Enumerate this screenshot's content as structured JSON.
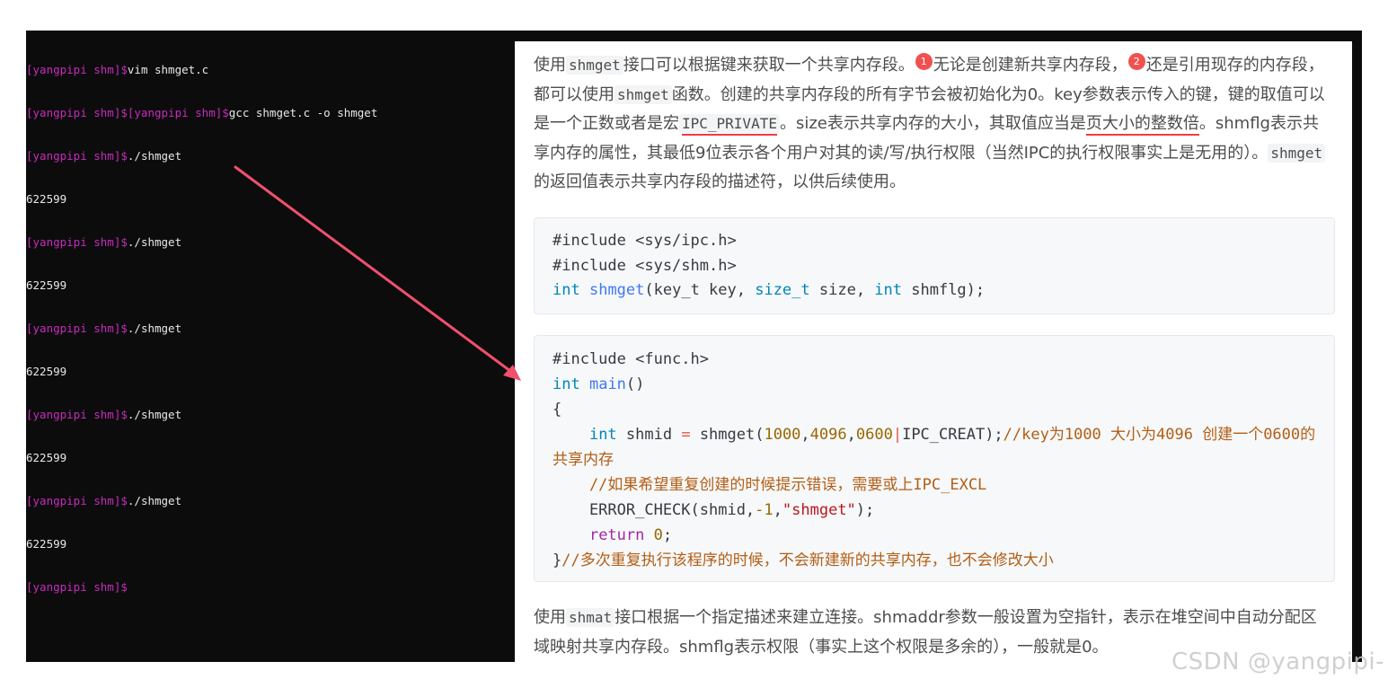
{
  "terminal": {
    "lines": [
      {
        "prompt": "[yangpipi shm]$",
        "cmd": "vim shmget.c"
      },
      {
        "prompt": "[yangpipi shm]$[yangpipi shm]$",
        "cmd": "gcc shmget.c -o shmget"
      },
      {
        "prompt": "[yangpipi shm]$",
        "cmd": "./shmget"
      },
      {
        "prompt": "",
        "cmd": "622599"
      },
      {
        "prompt": "[yangpipi shm]$",
        "cmd": "./shmget"
      },
      {
        "prompt": "",
        "cmd": "622599"
      },
      {
        "prompt": "[yangpipi shm]$",
        "cmd": "./shmget"
      },
      {
        "prompt": "",
        "cmd": "622599"
      },
      {
        "prompt": "[yangpipi shm]$",
        "cmd": "./shmget"
      },
      {
        "prompt": "",
        "cmd": "622599"
      },
      {
        "prompt": "[yangpipi shm]$",
        "cmd": "./shmget"
      },
      {
        "prompt": "",
        "cmd": "622599"
      },
      {
        "prompt": "[yangpipi shm]$",
        "cmd": ""
      }
    ]
  },
  "article": {
    "p1": {
      "t1": "使用",
      "c1": "shmget",
      "t2": "接口可以根据键来获取一个共享内存段。",
      "badge1": "1",
      "t3": "无论是创建新共享内存段，",
      "badge2": "2",
      "t4": "还是引用现存的内存段，都可以使用",
      "c2": "shmget",
      "t5": "函数。创建的共享内存段的所有字节会被初始化为0。key参数表示传入的键，键的取值可以是一个正数或者是宏",
      "c3": "IPC_PRIVATE",
      "t6": "。size表示共享内存的大小，其取值应当是",
      "u1": "页大小的整数倍",
      "t7": "。shmflg表示共享内存的属性，其最低9位表示各个用户对其的读/写/执行权限（当然IPC的执行权限事实上是无用的）。",
      "c4": "shmget",
      "t8": "的返回值表示共享内存段的描述符，以供后续使用。"
    },
    "code1": {
      "l1": "#include <sys/ipc.h>",
      "l2": "#include <sys/shm.h>",
      "l3_kw1": "int",
      "l3_fn": "shmget",
      "l3_a": "(key_t key, ",
      "l3_kw2": "size_t",
      "l3_b": " size, ",
      "l3_kw3": "int",
      "l3_c": " shmflg);"
    },
    "code2": {
      "l1": "#include <func.h>",
      "l2_kw": "int",
      "l2_fn": "main",
      "l2_rest": "()",
      "l3": "{",
      "l4_indent": "    ",
      "l4_kw": "int",
      "l4_a": " shmid ",
      "l4_op": "=",
      "l4_b": " shmget(",
      "l4_n1": "1000",
      "l4_c1": ",",
      "l4_n2": "4096",
      "l4_c2": ",",
      "l4_n3": "0600",
      "l4_op2": "|",
      "l4_d": "IPC_CREAT);",
      "l4_cmt": "//key为1000 大小为4096 创建一个0600的共享内存",
      "l5": "    //如果希望重复创建的时候提示错误，需要或上IPC_EXCL",
      "l6_a": "    ERROR_CHECK(shmid,",
      "l6_n": "-1",
      "l6_b": ",",
      "l6_s": "\"shmget\"",
      "l6_c": ");",
      "l7_indent": "    ",
      "l7_kw": "return",
      "l7_sp": " ",
      "l7_n": "0",
      "l7_e": ";",
      "l8_a": "}",
      "l8_cmt": "//多次重复执行该程序的时候，不会新建新的共享内存，也不会修改大小"
    },
    "p2": {
      "t1": "使用",
      "c1": "shmat",
      "t2": "接口根据一个指定描述来建立连接。shmaddr参数一般设置为空指针，表示在堆空间中自动分配区域映射共享内存段。shmflg表示权限（事实上这个权限是多余的），一般就是0。"
    }
  },
  "annotation": {
    "arrow_color": "#f0506e"
  },
  "watermark": "CSDN @yangpipi-"
}
